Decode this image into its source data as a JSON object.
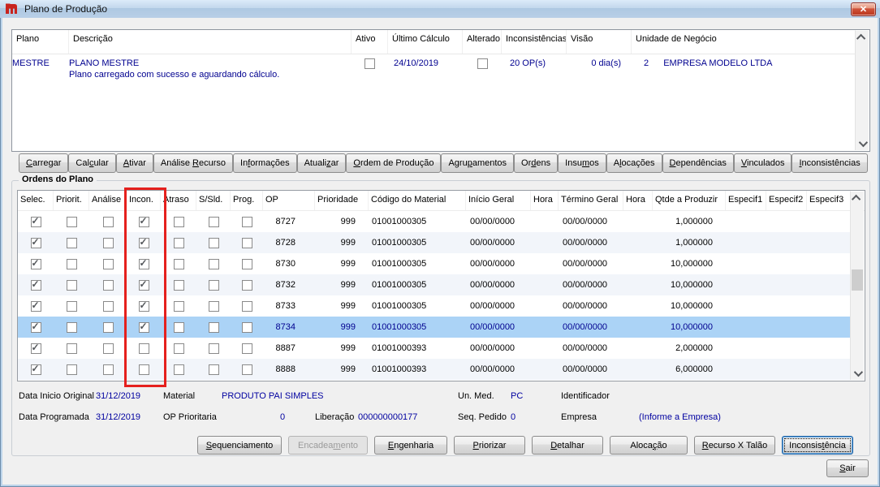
{
  "window": {
    "title": "Plano de Produção",
    "close_glyph": "✕"
  },
  "icons": {
    "app_icon": "red-company-logo",
    "check_glyph": "✓",
    "close": "x-close",
    "scroll_up": "chevron-up",
    "scroll_down": "chevron-down"
  },
  "colors": {
    "selection": "#abd3f6",
    "row_stripe": "#f2f5fa",
    "value_blue": "#0000a0",
    "highlight_red": "#e5201d"
  },
  "plans": {
    "columns": [
      "Plano",
      "Descrição",
      "Ativo",
      "Último Cálculo",
      "Alterado",
      "Inconsistências",
      "Visão",
      "Unidade de Negócio"
    ],
    "row": {
      "plano": "MESTRE",
      "descricao_titulo": "PLANO MESTRE",
      "descricao_status": "Plano carregado com sucesso e aguardando cálculo.",
      "ativo": false,
      "ultimo_calculo": "24/10/2019",
      "alterado": false,
      "inconsistencias": "20  OP(s)",
      "visao": "0  dia(s)",
      "unidade_codigo": "2",
      "unidade_nome": "EMPRESA MODELO LTDA"
    }
  },
  "toolbar": {
    "buttons": [
      {
        "label": "Carregar",
        "accel": 0
      },
      {
        "label": "Calcular",
        "accel": 3
      },
      {
        "label": "Ativar",
        "accel": 0
      },
      {
        "label": "Análise Recurso",
        "accel": 8
      },
      {
        "label": "Informações",
        "accel": 2
      },
      {
        "label": "Atualizar",
        "accel": 6
      },
      {
        "label": "Ordem de Produção",
        "accel": 0
      },
      {
        "label": "Agrupamentos",
        "accel": 4
      },
      {
        "label": "Ordens",
        "accel": 2
      },
      {
        "label": "Insumos",
        "accel": 4
      },
      {
        "label": "Alocações",
        "accel": 1
      },
      {
        "label": "Dependências",
        "accel": 0
      },
      {
        "label": "Vinculados",
        "accel": 0
      },
      {
        "label": "Inconsistências",
        "accel": 0
      }
    ]
  },
  "orders": {
    "group_title": "Ordens do Plano",
    "columns": [
      "Selec.",
      "Priorit.",
      "Análise",
      "Incon.",
      "Atraso",
      "S/Sld.",
      "Prog.",
      "OP",
      "Prioridade",
      "Código do Material",
      "Início Geral",
      "Hora",
      "Término Geral",
      "Hora",
      "Qtde a Produzir",
      "Especif1",
      "Especif2",
      "Especif3"
    ],
    "check_columns": [
      "selec",
      "priorit",
      "analise",
      "incon",
      "atraso",
      "ssld",
      "prog"
    ],
    "rows": [
      {
        "op": "8727",
        "prioridade": "999",
        "codigo": "01001000305",
        "inicio": "00/00/0000",
        "hora_inicio": "",
        "termino": "00/00/0000",
        "hora_termino": "",
        "qtde": "1,000000",
        "especif1": "",
        "especif2": "",
        "especif3": "",
        "selected": false,
        "checks": {
          "selec": true,
          "priorit": false,
          "analise": false,
          "incon": true,
          "atraso": false,
          "ssld": false,
          "prog": false
        }
      },
      {
        "op": "8728",
        "prioridade": "999",
        "codigo": "01001000305",
        "inicio": "00/00/0000",
        "hora_inicio": "",
        "termino": "00/00/0000",
        "hora_termino": "",
        "qtde": "1,000000",
        "especif1": "",
        "especif2": "",
        "especif3": "",
        "selected": false,
        "checks": {
          "selec": true,
          "priorit": false,
          "analise": false,
          "incon": true,
          "atraso": false,
          "ssld": false,
          "prog": false
        }
      },
      {
        "op": "8730",
        "prioridade": "999",
        "codigo": "01001000305",
        "inicio": "00/00/0000",
        "hora_inicio": "",
        "termino": "00/00/0000",
        "hora_termino": "",
        "qtde": "10,000000",
        "especif1": "",
        "especif2": "",
        "especif3": "",
        "selected": false,
        "checks": {
          "selec": true,
          "priorit": false,
          "analise": false,
          "incon": true,
          "atraso": false,
          "ssld": false,
          "prog": false
        }
      },
      {
        "op": "8732",
        "prioridade": "999",
        "codigo": "01001000305",
        "inicio": "00/00/0000",
        "hora_inicio": "",
        "termino": "00/00/0000",
        "hora_termino": "",
        "qtde": "10,000000",
        "especif1": "",
        "especif2": "",
        "especif3": "",
        "selected": false,
        "checks": {
          "selec": true,
          "priorit": false,
          "analise": false,
          "incon": true,
          "atraso": false,
          "ssld": false,
          "prog": false
        }
      },
      {
        "op": "8733",
        "prioridade": "999",
        "codigo": "01001000305",
        "inicio": "00/00/0000",
        "hora_inicio": "",
        "termino": "00/00/0000",
        "hora_termino": "",
        "qtde": "10,000000",
        "especif1": "",
        "especif2": "",
        "especif3": "",
        "selected": false,
        "checks": {
          "selec": true,
          "priorit": false,
          "analise": false,
          "incon": true,
          "atraso": false,
          "ssld": false,
          "prog": false
        }
      },
      {
        "op": "8734",
        "prioridade": "999",
        "codigo": "01001000305",
        "inicio": "00/00/0000",
        "hora_inicio": "",
        "termino": "00/00/0000",
        "hora_termino": "",
        "qtde": "10,000000",
        "especif1": "",
        "especif2": "",
        "especif3": "",
        "selected": true,
        "checks": {
          "selec": true,
          "priorit": false,
          "analise": false,
          "incon": true,
          "atraso": false,
          "ssld": false,
          "prog": false
        }
      },
      {
        "op": "8887",
        "prioridade": "999",
        "codigo": "01001000393",
        "inicio": "00/00/0000",
        "hora_inicio": "",
        "termino": "00/00/0000",
        "hora_termino": "",
        "qtde": "2,000000",
        "especif1": "",
        "especif2": "",
        "especif3": "",
        "selected": false,
        "checks": {
          "selec": true,
          "priorit": false,
          "analise": false,
          "incon": false,
          "atraso": false,
          "ssld": false,
          "prog": false
        }
      },
      {
        "op": "8888",
        "prioridade": "999",
        "codigo": "01001000393",
        "inicio": "00/00/0000",
        "hora_inicio": "",
        "termino": "00/00/0000",
        "hora_termino": "",
        "qtde": "6,000000",
        "especif1": "",
        "especif2": "",
        "especif3": "",
        "selected": false,
        "checks": {
          "selec": true,
          "priorit": false,
          "analise": false,
          "incon": false,
          "atraso": false,
          "ssld": false,
          "prog": false
        }
      }
    ]
  },
  "details": {
    "data_inicio_original_label": "Data Inicio Original",
    "data_inicio_original": "31/12/2019",
    "material_label": "Material",
    "material": "PRODUTO PAI SIMPLES",
    "un_med_label": "Un. Med.",
    "un_med": "PC",
    "identificador_label": "Identificador",
    "identificador": "",
    "data_programada_label": "Data Programada",
    "data_programada": "31/12/2019",
    "op_prioritaria_label": "OP Prioritaria",
    "op_prioritaria": "0",
    "liberacao_label": "Liberação",
    "liberacao": "000000000177",
    "seq_pedido_label": "Seq. Pedido",
    "seq_pedido": "0",
    "empresa_label": "Empresa",
    "empresa": "(Informe a Empresa)"
  },
  "actions": {
    "buttons": [
      {
        "label": "Sequenciamento",
        "accel": 0
      },
      {
        "label": "Encadeamento",
        "accel": 7,
        "disabled": true
      },
      {
        "label": "Engenharia",
        "accel": 0
      },
      {
        "label": "Priorizar",
        "accel": 0
      },
      {
        "label": "Detalhar",
        "accel": 0
      },
      {
        "label": "Alocação",
        "accel": 5
      },
      {
        "label": "Recurso X Talão",
        "accel": 0
      },
      {
        "label": "Inconsistência",
        "accel": 8,
        "focused": true
      }
    ]
  },
  "exit": {
    "label": "Sair",
    "accel": 0
  }
}
